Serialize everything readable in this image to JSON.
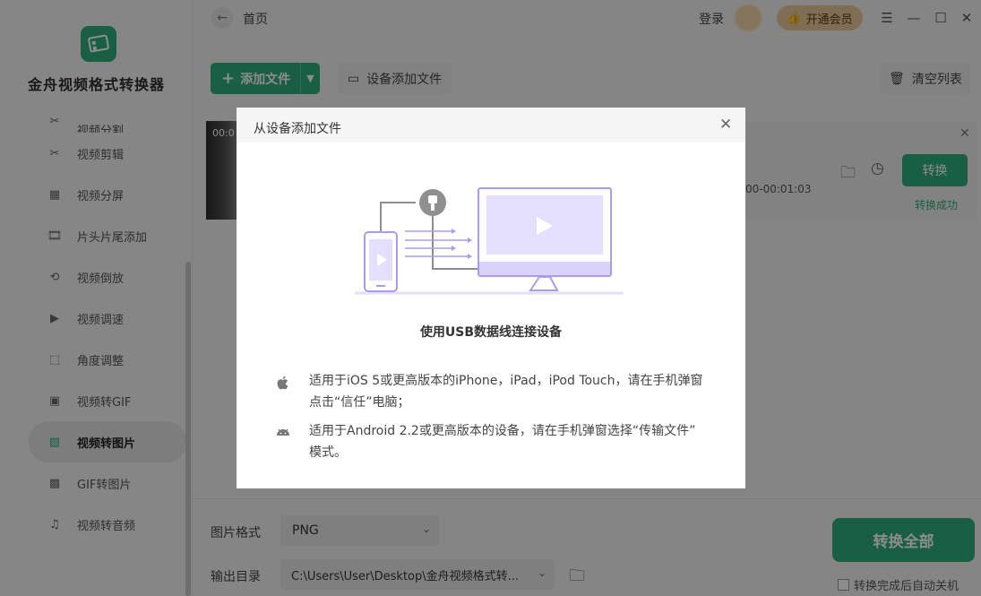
{
  "sidebar": {
    "app_title": "金舟视频格式转换器",
    "items": [
      {
        "label": "视频分割",
        "icon": "split-icon",
        "active": false,
        "partial": true
      },
      {
        "label": "视频剪辑",
        "icon": "scissors-icon",
        "active": false
      },
      {
        "label": "视频分屏",
        "icon": "split-screen-icon",
        "active": false
      },
      {
        "label": "片头片尾添加",
        "icon": "film-icon",
        "active": false
      },
      {
        "label": "视频倒放",
        "icon": "reverse-play-icon",
        "active": false
      },
      {
        "label": "视频调速",
        "icon": "speed-icon",
        "active": false
      },
      {
        "label": "角度调整",
        "icon": "rotate-icon",
        "active": false
      },
      {
        "label": "视频转GIF",
        "icon": "gif-icon",
        "active": false
      },
      {
        "label": "视频转图片",
        "icon": "image-icon",
        "active": true
      },
      {
        "label": "GIF转图片",
        "icon": "gif-image-icon",
        "active": false
      },
      {
        "label": "视频转音频",
        "icon": "music-icon",
        "active": false
      }
    ]
  },
  "topbar": {
    "breadcrumb": "首页",
    "login": "登录",
    "vip": "开通会员"
  },
  "toolbar": {
    "add_file": "添加文件",
    "device_add": "设备添加文件",
    "clear_list": "清空列表"
  },
  "file_row": {
    "thumb_time": "00:0",
    "time_range": "00-00:01:03",
    "convert": "转换",
    "status": "转换成功"
  },
  "bottom": {
    "format_label": "图片格式",
    "format_value": "PNG",
    "output_label": "输出目录",
    "output_value": "C:\\Users\\User\\Desktop\\金舟视频格式转...",
    "convert_all": "转换全部",
    "auto_shutdown": "转换完成后自动关机"
  },
  "dialog": {
    "title": "从设备添加文件",
    "caption": "使用USB数据线连接设备",
    "ios_line1": "适用于iOS 5或更高版本的iPhone，iPad，iPod Touch，请在手机弹窗",
    "ios_line2": "点击“信任”电脑；",
    "android_line1": "适用于Android 2.2或更高版本的设备，请在手机弹窗选择“传输文件”",
    "android_line2": "模式。"
  },
  "colors": {
    "accent": "#2fae7b",
    "vip": "#e8c99a",
    "illustration": "#a99cf0"
  }
}
